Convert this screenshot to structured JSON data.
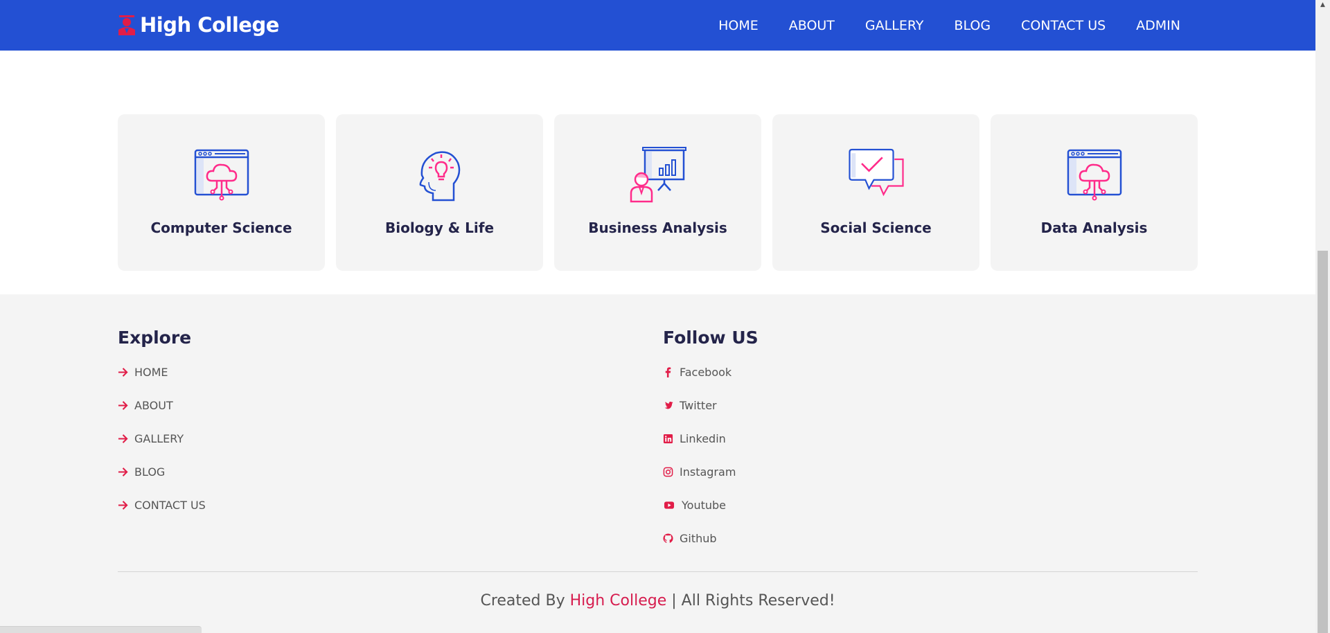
{
  "colors": {
    "nav_bg": "#2350d3",
    "accent": "#e11d48",
    "card_bg": "#f4f4f4",
    "heading": "#24244a",
    "footer_bg": "#f4f4f4"
  },
  "brand": {
    "name": "High College",
    "icon": "graduate-icon"
  },
  "nav": {
    "items": [
      {
        "label": "HOME"
      },
      {
        "label": "ABOUT"
      },
      {
        "label": "GALLERY"
      },
      {
        "label": "BLOG"
      },
      {
        "label": "CONTACT US"
      },
      {
        "label": "ADMIN"
      }
    ]
  },
  "categories": [
    {
      "title": "Computer Science",
      "icon": "cloud-browser-icon"
    },
    {
      "title": "Biology & Life",
      "icon": "head-lightbulb-icon"
    },
    {
      "title": "Business Analysis",
      "icon": "presentation-icon"
    },
    {
      "title": "Social Science",
      "icon": "chat-bubbles-icon"
    },
    {
      "title": "Data Analysis",
      "icon": "cloud-browser-icon"
    }
  ],
  "footer": {
    "explore": {
      "title": "Explore",
      "links": [
        {
          "label": "HOME",
          "icon": "arrow-right-icon"
        },
        {
          "label": "ABOUT",
          "icon": "arrow-right-icon"
        },
        {
          "label": "GALLERY",
          "icon": "arrow-right-icon"
        },
        {
          "label": "BLOG",
          "icon": "arrow-right-icon"
        },
        {
          "label": "CONTACT US",
          "icon": "arrow-right-icon"
        }
      ]
    },
    "follow": {
      "title": "Follow US",
      "links": [
        {
          "label": "Facebook",
          "icon": "facebook-icon"
        },
        {
          "label": "Twitter",
          "icon": "twitter-icon"
        },
        {
          "label": "Linkedin",
          "icon": "linkedin-icon"
        },
        {
          "label": "Instagram",
          "icon": "instagram-icon"
        },
        {
          "label": "Youtube",
          "icon": "youtube-icon"
        },
        {
          "label": "Github",
          "icon": "github-icon"
        }
      ]
    },
    "copyright": {
      "prefix": "Created By",
      "brand": "High College",
      "suffix": "| All Rights Reserved!"
    }
  }
}
